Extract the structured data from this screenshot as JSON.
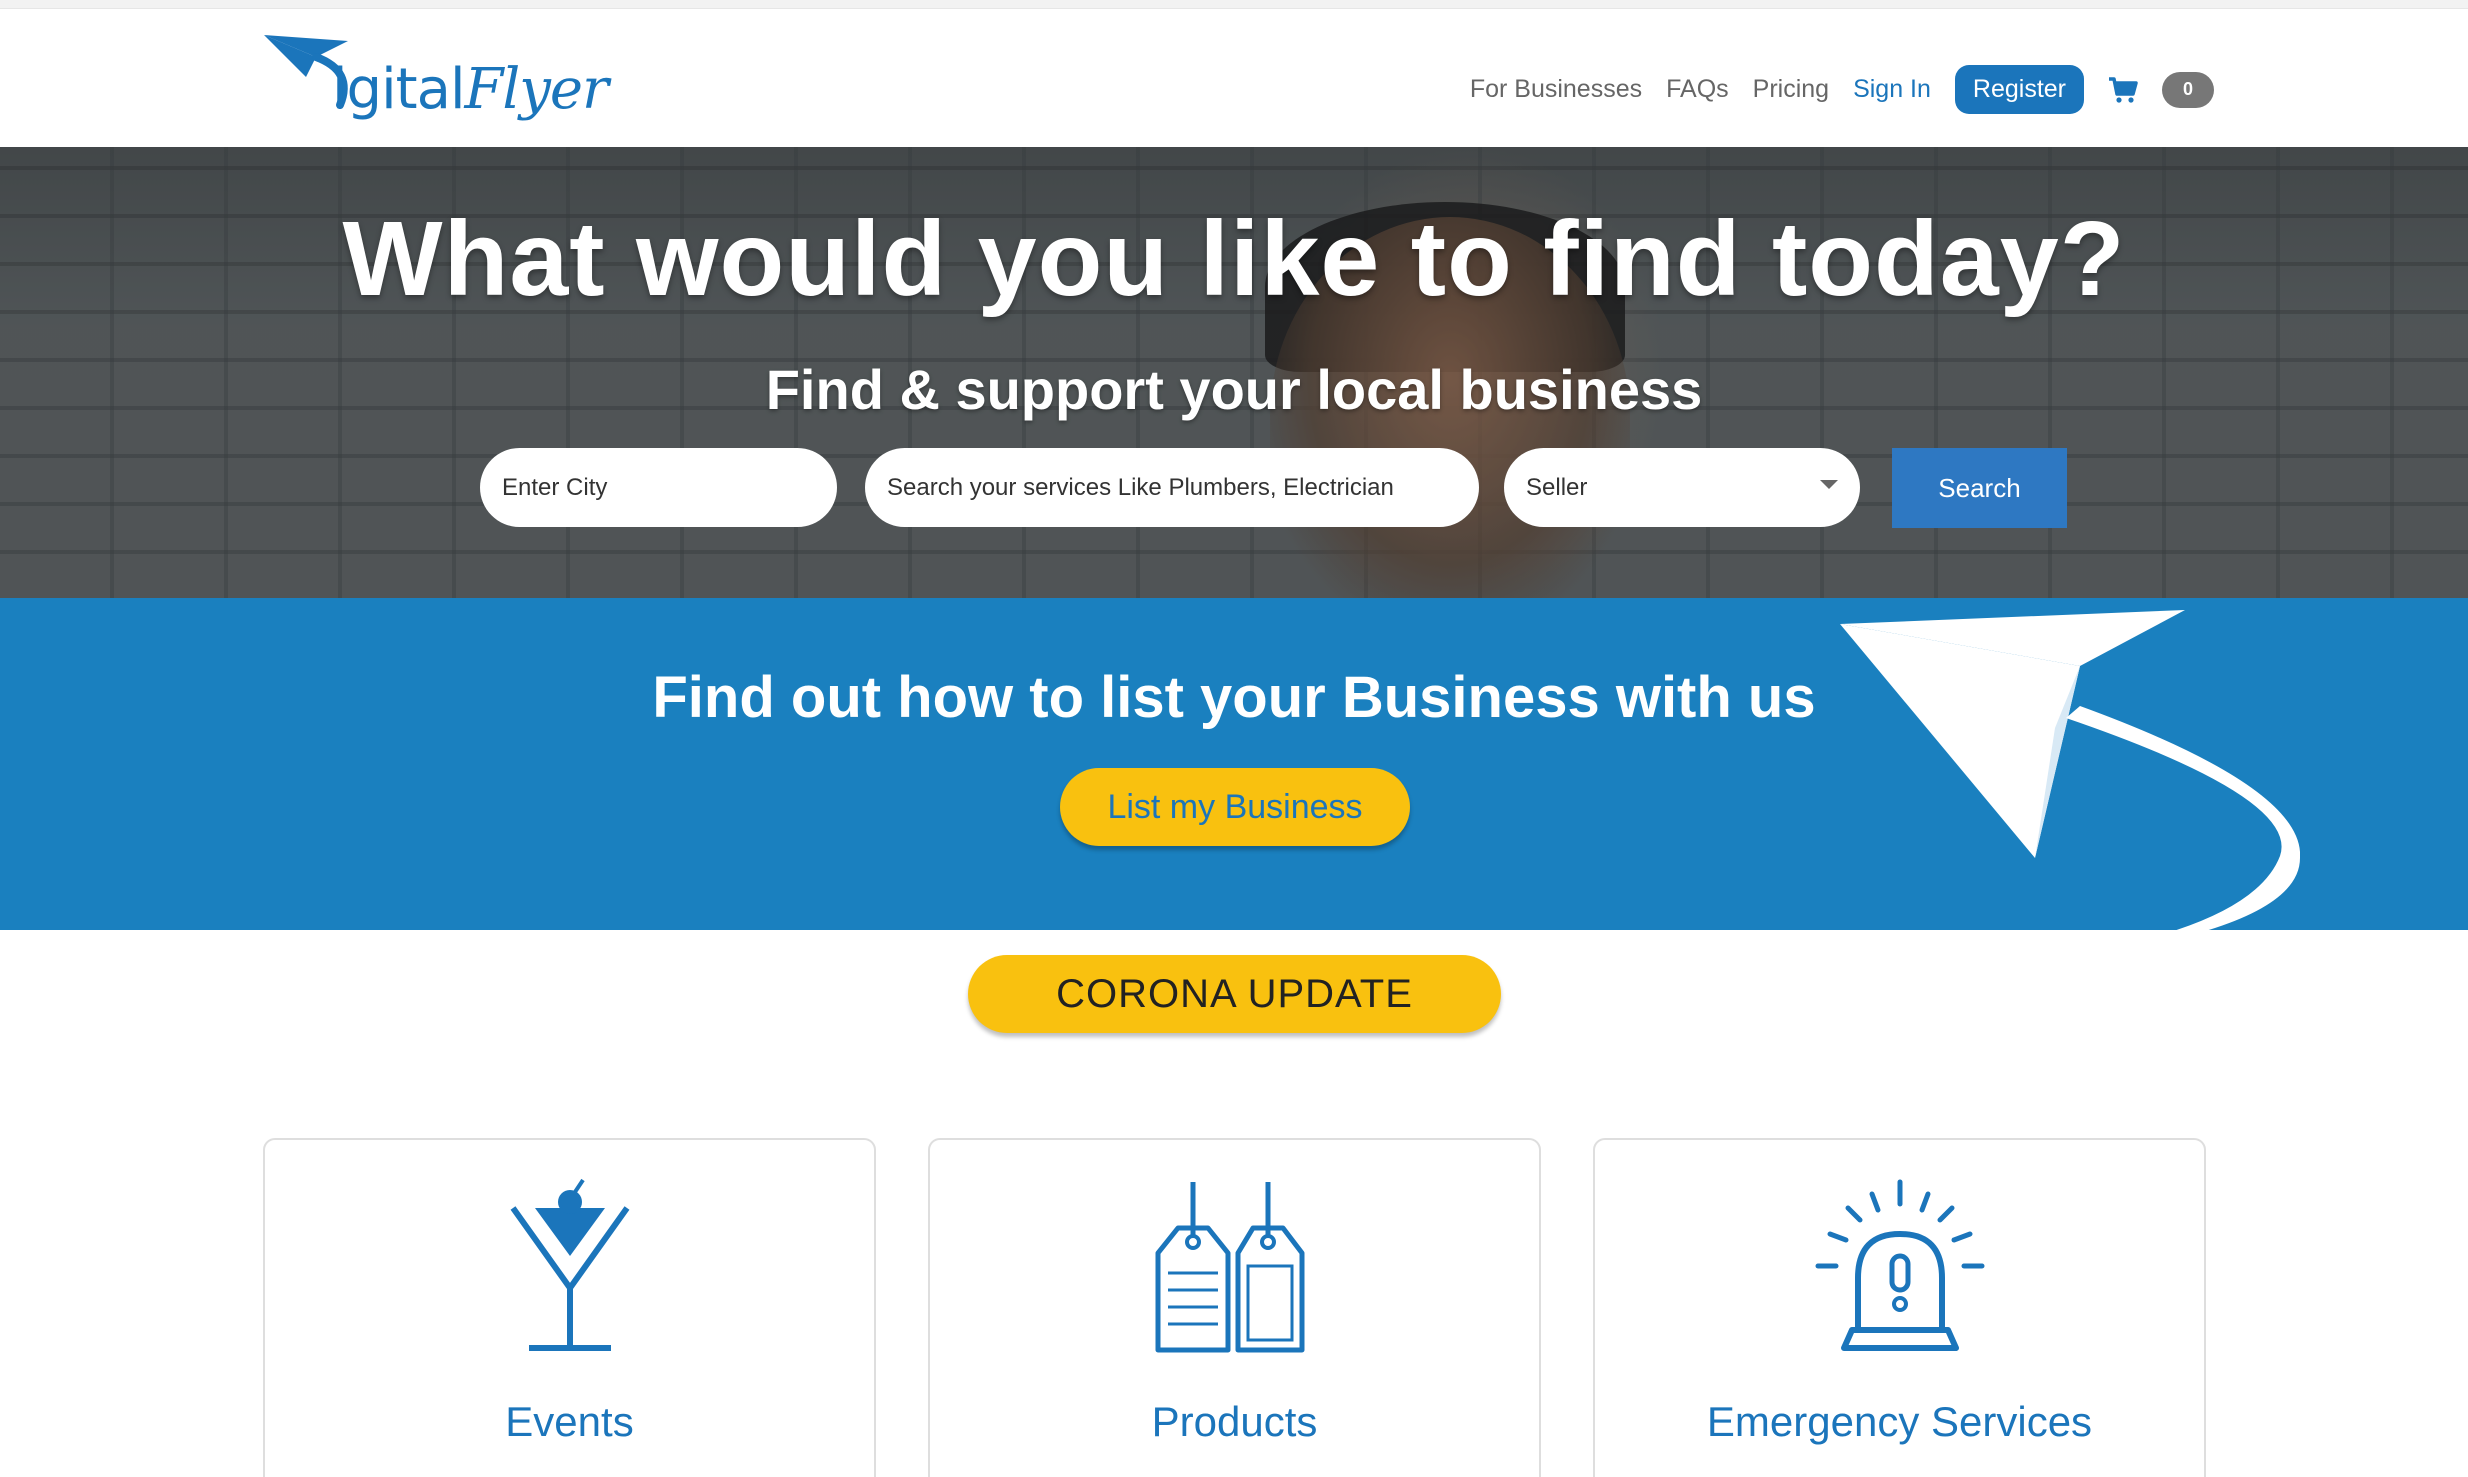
{
  "logo": {
    "text_main": "igital",
    "text_script": "Flyer",
    "mark": "paper-plane-icon"
  },
  "nav": {
    "for_businesses": "For Businesses",
    "faqs": "FAQs",
    "pricing": "Pricing",
    "sign_in": "Sign In",
    "register": "Register",
    "cart_count": "0"
  },
  "hero": {
    "title": "What would you like to find today?",
    "subtitle": "Find & support your local business",
    "city_placeholder": "Enter City",
    "service_placeholder": "Search your services Like Plumbers, Electrician",
    "type_selected": "Seller",
    "search_label": "Search"
  },
  "band": {
    "title": "Find out how to list your Business with us",
    "button": "List my Business"
  },
  "corona": {
    "button": "CORONA UPDATE"
  },
  "cards": [
    {
      "label": "Events",
      "icon": "cocktail-glass-icon"
    },
    {
      "label": "Products",
      "icon": "price-tags-icon"
    },
    {
      "label": "Emergency Services",
      "icon": "alarm-siren-icon"
    }
  ],
  "colors": {
    "brand_blue": "#1b75bb",
    "band_blue": "#1a80bf",
    "accent_yellow": "#f9c10f",
    "search_blue": "#2e78c2"
  }
}
